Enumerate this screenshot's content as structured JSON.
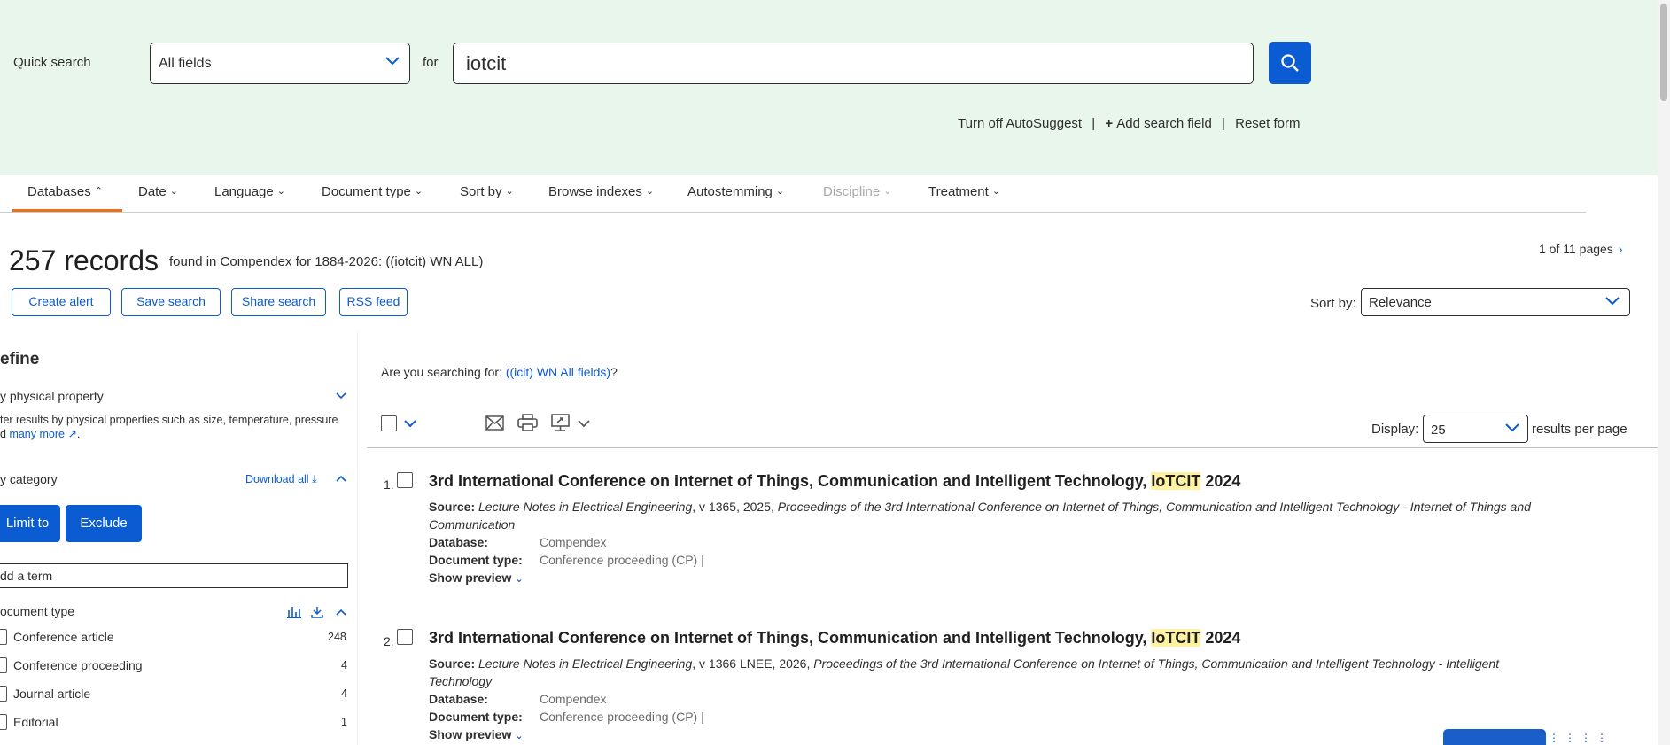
{
  "search": {
    "quick_search_label": "Quick search",
    "field_selected": "All fields",
    "for_label": "for",
    "query": "iotcit",
    "links": {
      "autosuggest": "Turn off AutoSuggest",
      "add_field": "Add search field",
      "reset": "Reset form",
      "separator": "|"
    }
  },
  "tabs": [
    {
      "label": "Databases",
      "state": "open"
    },
    {
      "label": "Date"
    },
    {
      "label": "Language"
    },
    {
      "label": "Document type"
    },
    {
      "label": "Sort by"
    },
    {
      "label": "Browse indexes"
    },
    {
      "label": "Autostemming"
    },
    {
      "label": "Discipline",
      "state": "disabled"
    },
    {
      "label": "Treatment"
    }
  ],
  "results_header": {
    "records": "257 records",
    "found_text": "found in Compendex for 1884-2026: ((iotcit) WN ALL)",
    "pages": "1 of 11 pages",
    "buttons": {
      "create_alert": "Create alert",
      "save_search": "Save search",
      "share_search": "Share search",
      "rss_feed": "RSS feed"
    },
    "sort_label": "Sort by:",
    "sort_value": "Relevance"
  },
  "refine": {
    "title": "efine",
    "physical_property_title": "y physical property",
    "physical_property_desc_1": "ter results by physical properties such as size, temperature, pressure",
    "physical_property_desc_2_prefix": "d ",
    "physical_property_link": "many more",
    "physical_property_desc_2_suffix": ".",
    "category_title": "y category",
    "download_all": "Download all",
    "limit_to": "Limit to",
    "exclude": "Exclude",
    "add_term_placeholder": "dd a term",
    "doc_type_title": "ocument type",
    "doc_types": [
      {
        "label": "Conference article",
        "count": "248"
      },
      {
        "label": "Conference proceeding",
        "count": "4"
      },
      {
        "label": "Journal article",
        "count": "4"
      },
      {
        "label": "Editorial",
        "count": "1"
      }
    ]
  },
  "main": {
    "suggest_prefix": "Are you searching for: ",
    "suggest_link": "((icit) WN All fields)",
    "suggest_suffix": "?",
    "display_label": "Display:",
    "display_value": "25",
    "per_page": "results per page"
  },
  "results": [
    {
      "num": "1.",
      "title_pre": "3rd International Conference on Internet of Things, Communication and Intelligent Technology, ",
      "title_hl": "IoTCIT",
      "title_post": " 2024",
      "source_label": "Source:",
      "source_italic_1": "Lecture Notes in Electrical Engineering",
      "source_plain": ", v 1365, 2025, ",
      "source_italic_2": "Proceedings of the 3rd International Conference on Internet of Things, Communication and Intelligent Technology - Internet of Things and Communication",
      "database_label": "Database:",
      "database": "Compendex",
      "doctype_label": "Document type:",
      "doctype": "Conference proceeding (CP) |",
      "preview": "Show preview"
    },
    {
      "num": "2.",
      "title_pre": "3rd International Conference on Internet of Things, Communication and Intelligent Technology, ",
      "title_hl": "IoTCIT",
      "title_post": " 2024",
      "source_label": "Source:",
      "source_italic_1": "Lecture Notes in Electrical Engineering",
      "source_plain": ", v 1366 LNEE, 2026, ",
      "source_italic_2": "Proceedings of the 3rd International Conference on Internet of Things, Communication and Intelligent Technology - Intelligent Technology",
      "database_label": "Database:",
      "database": "Compendex",
      "doctype_label": "Document type:",
      "doctype": "Conference proceeding (CP) |",
      "preview": "Show preview"
    }
  ],
  "colors": {
    "accent": "#0b5bd3",
    "banner_bg": "#e8f6ec",
    "tab_underline": "#e9711c",
    "highlight": "#fff3a3"
  }
}
